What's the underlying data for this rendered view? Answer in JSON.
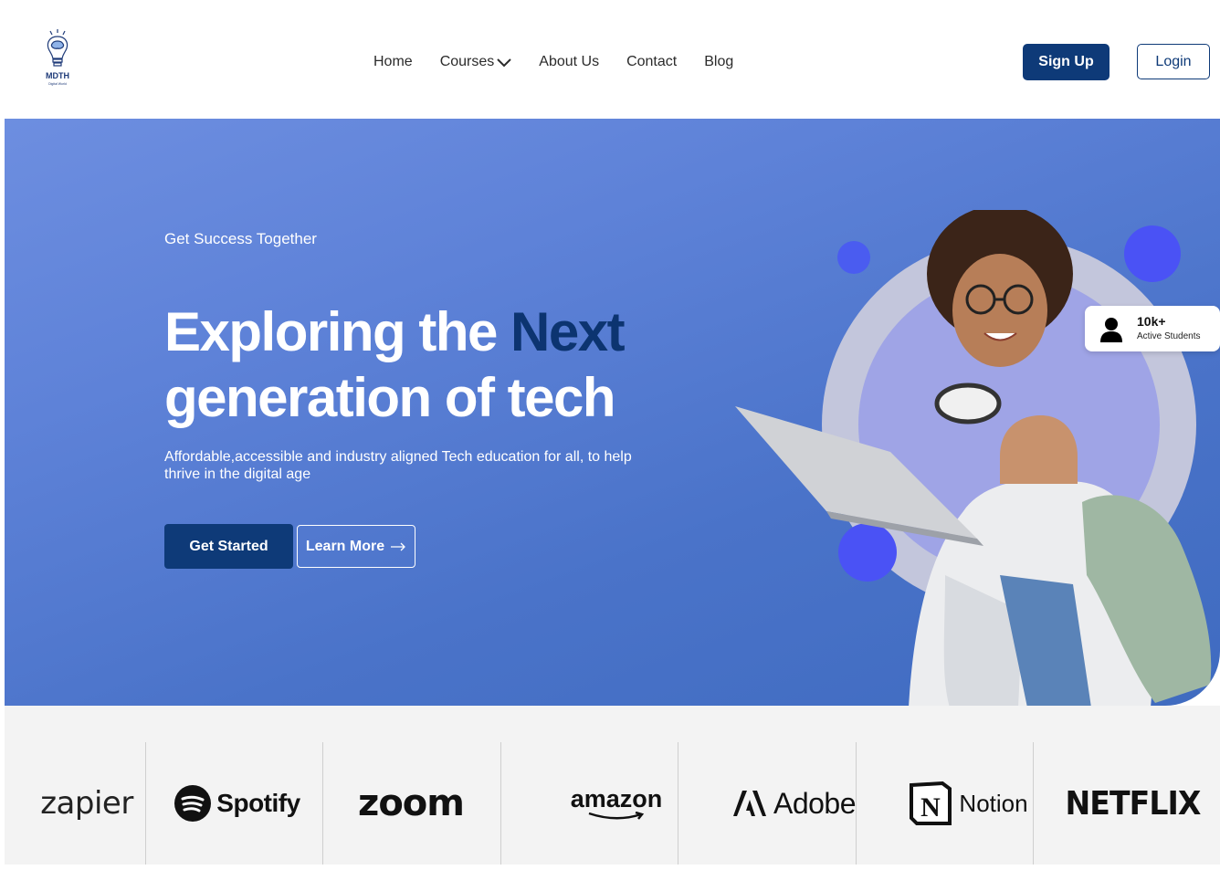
{
  "brand": {
    "name": "MDTH",
    "tagline": "Digital World"
  },
  "nav": {
    "items": [
      "Home",
      "Courses",
      "About Us",
      "Contact",
      "Blog"
    ]
  },
  "auth": {
    "signup_label": "Sign Up",
    "login_label": "Login"
  },
  "hero": {
    "kicker": "Get Success Together",
    "headline_part1": "Exploring the ",
    "headline_accent": "Next",
    "headline_part2": "generation of tech",
    "subtitle": "Affordable,accessible and industry aligned Tech education for all, to help thrive in the digital age",
    "cta_primary": "Get Started",
    "cta_secondary": "Learn More"
  },
  "badge": {
    "count": "10k+",
    "label": "Active Students"
  },
  "partners": [
    "zapier",
    "Spotify",
    "zoom",
    "amazon",
    "Adobe",
    "Notion",
    "NETFLIX"
  ],
  "colors": {
    "primary": "#0e3a78",
    "hero_bg": "#5a7fd6",
    "accent_dot": "#4a5cf0",
    "logo_strip": "#f3f3f3"
  }
}
